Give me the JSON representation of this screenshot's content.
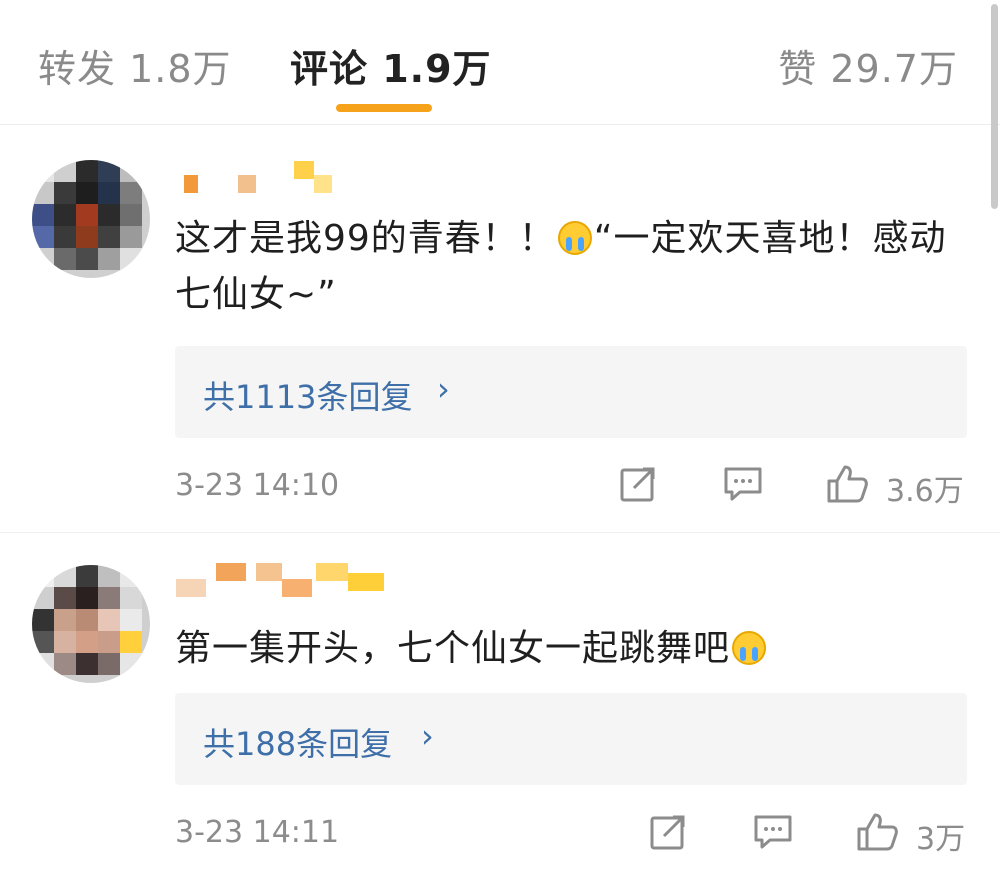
{
  "tabs": {
    "repost": "转发 1.8万",
    "comments": "评论 1.9万",
    "likes": "赞 29.7万",
    "active_color": "#f7a21b"
  },
  "comments": [
    {
      "text_before_emoji": "这才是我99的青春！！",
      "emoji": "crying-face-emoji",
      "text_after_emoji": "“一定欢天喜地！感动七仙女~”",
      "replies_label": "共1113条回复",
      "replies_chevron": "›",
      "time": "3-23 14:10",
      "likes": "3.6万"
    },
    {
      "text_before_emoji": "第一集开头，七个仙女一起跳舞吧",
      "emoji": "crying-face-emoji",
      "text_after_emoji": "",
      "replies_label": "共188条回复",
      "replies_chevron": "›",
      "time": "3-23 14:11",
      "likes": "3万"
    }
  ],
  "colors": {
    "link": "#3e6fa9",
    "meta": "#8c8c8c"
  }
}
